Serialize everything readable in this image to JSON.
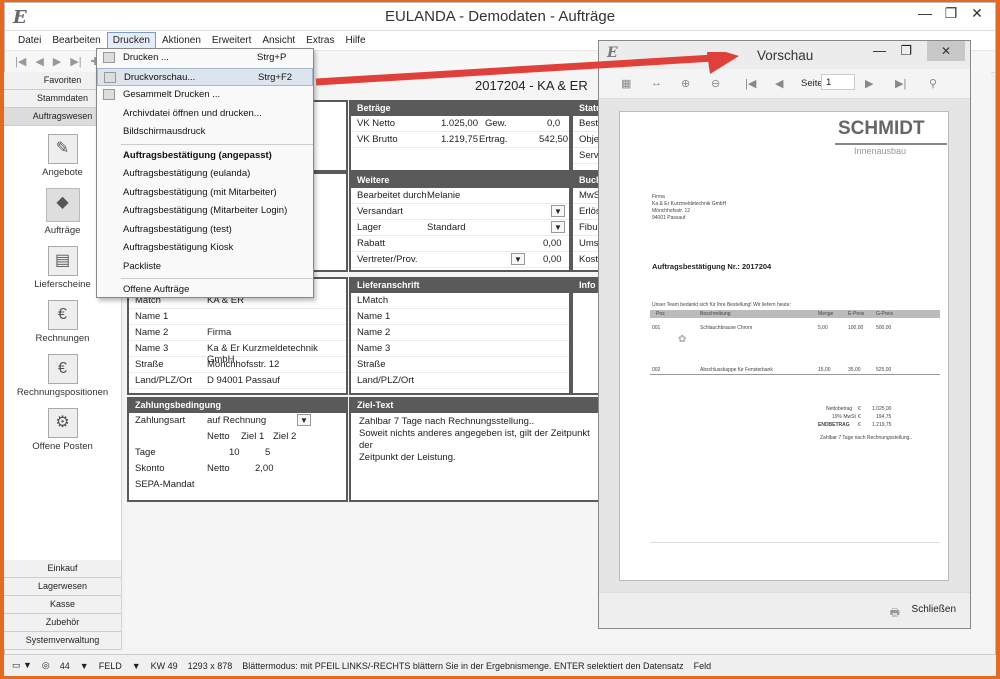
{
  "app": {
    "title": "EULANDA - Demodaten - Aufträge",
    "logo": "E"
  },
  "menubar": {
    "items": [
      "Datei",
      "Bearbeiten",
      "Drucken",
      "Aktionen",
      "Erweitert",
      "Ansicht",
      "Extras",
      "Hilfe"
    ]
  },
  "sidebar": {
    "top": [
      "Favoriten",
      "Stammdaten",
      "Auftragswesen"
    ],
    "icons": [
      "Angebote",
      "Aufträge",
      "Lieferscheine",
      "Rechnungen",
      "Rechnungspositionen",
      "Offene Posten"
    ],
    "bottom": [
      "Einkauf",
      "Lagerwesen",
      "Kasse",
      "Zubehör",
      "Systemverwaltung"
    ]
  },
  "header": {
    "record": "2017204 - KA & ER"
  },
  "betraege": {
    "title": "Beträge",
    "vk_netto_label": "VK Netto",
    "vk_netto": "1.025,00",
    "gew_label": "Gew.",
    "gew": "0,0",
    "vk_brutto_label": "VK Brutto",
    "vk_brutto": "1.219,75",
    "ertrag_label": "Ertrag.",
    "ertrag": "542,50"
  },
  "status": {
    "title": "Status",
    "l1": "Beste",
    "l2": "Obje",
    "l3": "Servi"
  },
  "weitere": {
    "title": "Weitere",
    "rows": [
      {
        "k": "Bearbeitet durch",
        "v": "Melanie"
      },
      {
        "k": "Versandart",
        "v": ""
      },
      {
        "k": "Lager",
        "v": "Standard"
      },
      {
        "k": "Rabatt",
        "v": "0,00"
      },
      {
        "k": "Vertreter/Prov.",
        "v": "0,00"
      }
    ]
  },
  "buch": {
    "title": "Buch",
    "l": [
      "MwS",
      "Erlös",
      "Fibu",
      "Ums",
      "Kost"
    ]
  },
  "left_addr": {
    "rows": [
      {
        "k": "Match",
        "v": "KA & ER"
      },
      {
        "k": "Name 1",
        "v": ""
      },
      {
        "k": "Name 2",
        "v": "Firma"
      },
      {
        "k": "Name 3",
        "v": "Ka & Er Kurzmeldetechnik GmbH"
      },
      {
        "k": "Straße",
        "v": "Mönchhofsstr. 12"
      },
      {
        "k": "Land/PLZ/Ort",
        "v": "D     94001  Passauf"
      }
    ]
  },
  "lieferanschrift": {
    "title": "Lieferanschrift",
    "rows": [
      "LMatch",
      "Name 1",
      "Name 2",
      "Name 3",
      "Straße",
      "Land/PLZ/Ort"
    ]
  },
  "info": {
    "title": "Info"
  },
  "zahlung": {
    "title": "Zahlungsbedingung",
    "art_label": "Zahlungsart",
    "art": "auf Rechnung",
    "h_netto": "Netto",
    "h_ziel1": "Ziel 1",
    "h_ziel2": "Ziel 2",
    "tage_label": "Tage",
    "tage_v1": "10",
    "tage_v2": "5",
    "skonto_label": "Skonto",
    "skonto_netto": "Netto",
    "skonto_v": "2,00",
    "sepa": "SEPA-Mandat"
  },
  "ziel": {
    "title": "Ziel-Text",
    "text": "Zahlbar 7 Tage nach Rechnungsstellung..\nSoweit nichts anderes angegeben ist, gilt der Zeitpunkt der\nZeitpunkt der Leistung."
  },
  "menu": {
    "items": [
      {
        "label": "Drucken ...",
        "sc": "Strg+P",
        "icon": "printer-icon"
      },
      {
        "label": "Druckvorschau...",
        "sc": "Strg+F2",
        "icon": "preview-icon"
      },
      {
        "label": "Gesammelt Drucken ...",
        "sc": "",
        "icon": "batch-print-icon"
      },
      {
        "label": "Archivdatei öffnen und drucken...",
        "sc": ""
      },
      {
        "label": "Bildschirmausdruck",
        "sc": ""
      },
      {
        "label": "Auftragsbestätigung (angepasst)",
        "sc": "",
        "bold": true
      },
      {
        "label": "Auftragsbestätigung (eulanda)",
        "sc": ""
      },
      {
        "label": "Auftragsbestätigung (mit Mitarbeiter)",
        "sc": ""
      },
      {
        "label": "Auftragsbestätigung (Mitarbeiter Login)",
        "sc": ""
      },
      {
        "label": "Auftragsbestätigung (test)",
        "sc": ""
      },
      {
        "label": "Auftragsbestätigung Kiosk",
        "sc": ""
      },
      {
        "label": "Packliste",
        "sc": ""
      },
      {
        "label": "Offene Aufträge",
        "sc": ""
      }
    ]
  },
  "preview": {
    "title": "Vorschau",
    "page_label": "Seite",
    "page": "1",
    "close": "Schließen",
    "doc": {
      "company": "SCHMIDT",
      "sub": "Innenausbau",
      "addr": [
        "Firma",
        "Ka & Er Kurzmeldetechnik GmbH",
        "Mönchhofsstr. 12",
        "94001 Passauf"
      ],
      "heading": "Auftragsbestätigung Nr.: 2017204",
      "intro": "Unser Team bedankt sich für Ihre Bestellung! Wir liefern heute:",
      "col_pos": "Pos",
      "col_desc": "Beschreibung",
      "col_qty": "Menge",
      "col_ep": "E-Preis",
      "col_gp": "G-Preis",
      "items": [
        {
          "pos": "001",
          "desc": "Schlauchbrause Chrom",
          "qty": "5,00",
          "ep": "100,00",
          "gp": "500,00"
        },
        {
          "pos": "002",
          "desc": "Abschlusskappe für Fensterbank",
          "qty": "15,00",
          "ep": "35,00",
          "gp": "525,00"
        }
      ],
      "sum_labels": [
        "Nettobetrag",
        "19% MwSt",
        "ENDBETRAG"
      ],
      "sum_cur": "€",
      "sum_vals": [
        "1.025,00",
        "194,75",
        "1.219,75"
      ],
      "footnote": "Zahlbar 7 Tage nach Rechnungsstellung.."
    }
  },
  "statusbar": {
    "zoom": "44",
    "feld": "FELD",
    "kw": "KW 49",
    "dims": "1293 x 878",
    "msg": "Blättermodus: mit PFEIL LINKS/-RECHTS blättern Sie in der Ergebnismenge. ENTER selektiert den Datensatz",
    "feld2": "Feld"
  },
  "colors": {
    "accent": "#e46a1f",
    "arrow": "#e0403a"
  }
}
